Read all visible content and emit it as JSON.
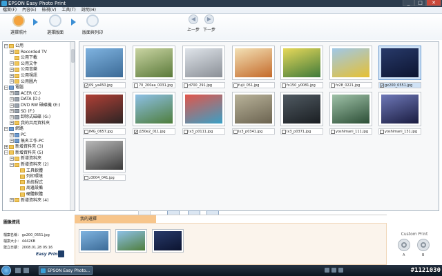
{
  "window": {
    "title": "EPSON Easy Photo Print",
    "min_label": "_",
    "max_label": "□",
    "close_label": "✕"
  },
  "menu": [
    "檔案(F)",
    "內容(E)",
    "檢視(V)",
    "工具(T)",
    "說明(H)"
  ],
  "toolbar": {
    "steps": [
      {
        "label": "選擇照片",
        "icon": "photo-select-icon",
        "active": true
      },
      {
        "label": "選擇版面",
        "icon": "layout-select-icon",
        "active": false
      },
      {
        "label": "版面與列印",
        "icon": "print-icon",
        "active": false
      }
    ],
    "prev_label": "上一步",
    "next_label": "下一步"
  },
  "tree": [
    {
      "label": "公用",
      "level": 1,
      "icon": "folder",
      "exp": "−"
    },
    {
      "label": "Recorded TV",
      "level": 2,
      "icon": "folder",
      "exp": "+"
    },
    {
      "label": "公用下載",
      "level": 2,
      "icon": "folder",
      "exp": ""
    },
    {
      "label": "公用文件",
      "level": 2,
      "icon": "folder",
      "exp": "+"
    },
    {
      "label": "公用音樂",
      "level": 2,
      "icon": "folder",
      "exp": "+"
    },
    {
      "label": "公用視訊",
      "level": 2,
      "icon": "folder",
      "exp": "+"
    },
    {
      "label": "公用圖片",
      "level": 2,
      "icon": "folder",
      "exp": "+"
    },
    {
      "label": "電腦",
      "level": 1,
      "icon": "computer",
      "exp": "−"
    },
    {
      "label": "ACER (C:)",
      "level": 2,
      "icon": "drive",
      "exp": "+"
    },
    {
      "label": "DATA (D:)",
      "level": 2,
      "icon": "drive",
      "exp": "+"
    },
    {
      "label": "DVD RW 磁碟機 (E:)",
      "level": 2,
      "icon": "drive",
      "exp": "+"
    },
    {
      "label": "SD (F:)",
      "level": 2,
      "icon": "drive",
      "exp": "+"
    },
    {
      "label": "卸除式磁碟 (G:)",
      "level": 2,
      "icon": "drive",
      "exp": "+"
    },
    {
      "label": "我的共用資料夾",
      "level": 2,
      "icon": "folder",
      "exp": "+"
    },
    {
      "label": "網路",
      "level": 1,
      "icon": "computer",
      "exp": "−"
    },
    {
      "label": "PC",
      "level": 2,
      "icon": "computer",
      "exp": "+"
    },
    {
      "label": "無名工作-PC",
      "level": 2,
      "icon": "computer",
      "exp": "+"
    },
    {
      "label": "新增資料夾 (3)",
      "level": 1,
      "icon": "folder",
      "exp": "+"
    },
    {
      "label": "新增資料夾 (5)",
      "level": 1,
      "icon": "folder",
      "exp": "−"
    },
    {
      "label": "新增資料夾",
      "level": 2,
      "icon": "folder",
      "exp": "+"
    },
    {
      "label": "新增資料夾 (2)",
      "level": 2,
      "icon": "folder",
      "exp": "−"
    },
    {
      "label": "工具軟體",
      "level": 3,
      "icon": "folder",
      "exp": ""
    },
    {
      "label": "列印環境",
      "level": 3,
      "icon": "folder",
      "exp": ""
    },
    {
      "label": "系統程式",
      "level": 3,
      "icon": "folder",
      "exp": ""
    },
    {
      "label": "周邊設備",
      "level": 3,
      "icon": "folder",
      "exp": ""
    },
    {
      "label": "硬體軟體",
      "level": 3,
      "icon": "folder",
      "exp": ""
    },
    {
      "label": "新增資料夾 (4)",
      "level": 2,
      "icon": "folder",
      "exp": "+"
    }
  ],
  "photos": [
    {
      "name": "09_ya450.jpg",
      "checked": true,
      "selected": false,
      "colors": [
        "#7fb3e0",
        "#3b6a96"
      ]
    },
    {
      "name": "70_200aa_0031.jpg",
      "checked": false,
      "selected": false,
      "colors": [
        "#c9d4a2",
        "#5b7a3a"
      ]
    },
    {
      "name": "d700_291.jpg",
      "checked": false,
      "selected": false,
      "colors": [
        "#dfe4ea",
        "#8a8f96"
      ]
    },
    {
      "name": "fujii_051.jpg",
      "checked": false,
      "selected": false,
      "colors": [
        "#f3e1b6",
        "#c46a2a"
      ]
    },
    {
      "name": "fx150_y0081.jpg",
      "checked": false,
      "selected": false,
      "colors": [
        "#e7d85a",
        "#3f7a3a"
      ]
    },
    {
      "name": "fz28_0221.jpg",
      "checked": false,
      "selected": false,
      "colors": [
        "#a0c8e8",
        "#e6c032"
      ]
    },
    {
      "name": "gx200_0551.jpg",
      "checked": true,
      "selected": true,
      "colors": [
        "#283a6a",
        "#0c1430"
      ]
    },
    {
      "name": "IMG_0657.jpg",
      "checked": false,
      "selected": false,
      "colors": [
        "#b04036",
        "#2c2424"
      ]
    },
    {
      "name": "j150e2_011.jpg",
      "checked": true,
      "selected": false,
      "colors": [
        "#8dc0e6",
        "#4f7e3c"
      ]
    },
    {
      "name": "lx3_p0111.jpg",
      "checked": false,
      "selected": false,
      "colors": [
        "#e2554a",
        "#3aa0c6"
      ]
    },
    {
      "name": "lx3_p0341.jpg",
      "checked": false,
      "selected": false,
      "colors": [
        "#b9b39a",
        "#6b6350"
      ]
    },
    {
      "name": "lx3_p0371.jpg",
      "checked": false,
      "selected": false,
      "colors": [
        "#505a62",
        "#1a1e22"
      ]
    },
    {
      "name": "yoshimani_111.jpg",
      "checked": false,
      "selected": false,
      "colors": [
        "#9fc2a8",
        "#2c4e36"
      ]
    },
    {
      "name": "yoshimani_131.jpg",
      "checked": false,
      "selected": false,
      "colors": [
        "#6e78b8",
        "#1a1c40"
      ]
    },
    {
      "name": "z3004_041.jpg",
      "checked": false,
      "selected": false,
      "colors": [
        "#b9b9b9",
        "#3a3a3a"
      ]
    }
  ],
  "info": {
    "title": "圖像資訊",
    "rows": [
      {
        "label": "檔案名稱：",
        "value": "gx200_0551.jpg"
      },
      {
        "label": "檔案大小：",
        "value": "4442KB"
      },
      {
        "label": "建立日期：",
        "value": "2008.01.28 05:16"
      }
    ],
    "logo": "Easy Print"
  },
  "tray": {
    "title": "我的選擇",
    "items": [
      {
        "name": "09_ya450.jpg",
        "colors": [
          "#7fb3e0",
          "#3b6a96"
        ]
      },
      {
        "name": "j150e2_011.jpg",
        "colors": [
          "#8dc0e6",
          "#4f7e3c"
        ]
      },
      {
        "name": "gx200_0551.jpg",
        "colors": [
          "#283a6a",
          "#0c1430"
        ]
      }
    ]
  },
  "custom_print": {
    "title": "Custom Print",
    "a_label": "A",
    "b_label": "B"
  },
  "taskbar": {
    "app_label": "EPSON Easy Photo...",
    "clock": "#1121030"
  }
}
